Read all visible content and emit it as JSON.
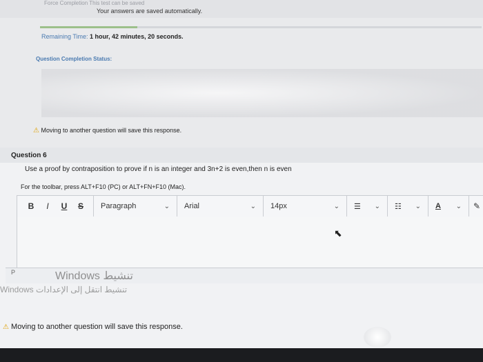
{
  "header": {
    "force_completion_text": "Force Completion  This test can be saved",
    "autosave_text": "Your answers are saved automatically."
  },
  "timer": {
    "label": "Remaining Time:",
    "value": "1 hour, 42 minutes, 20 seconds."
  },
  "progress": {
    "fraction": 0.22
  },
  "status": {
    "label": "Question Completion Status:"
  },
  "warning_top": "Moving to another question will save this response.",
  "question": {
    "title": "Question 6",
    "text": "Use a proof by contraposition to prove if n is an integer and 3n+2 is even,then n is even",
    "toolbar_hint": "For the toolbar, press ALT+F10 (PC) or ALT+FN+F10 (Mac)."
  },
  "toolbar": {
    "bold": "B",
    "italic": "I",
    "underline": "U",
    "strike": "S",
    "paragraph": "Paragraph",
    "font": "Arial",
    "size": "14px"
  },
  "editor": {
    "path_tag": "P"
  },
  "watermark": {
    "line1": "Windows تنشيط",
    "line2": "Windows تنشيط انتقل إلى الإعدادات"
  },
  "warning_bottom": "Moving to another question will save this response."
}
